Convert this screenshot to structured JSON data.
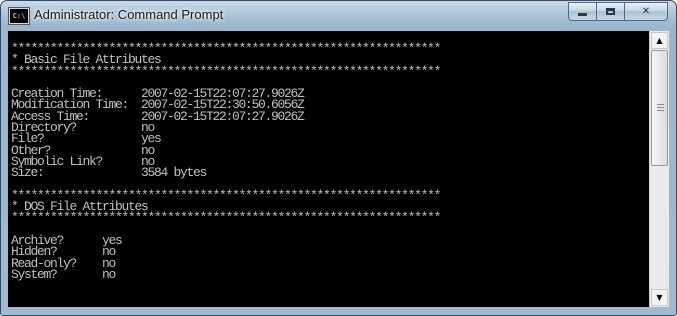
{
  "window": {
    "title": "Administrator: Command Prompt",
    "icon_label": "C:\\"
  },
  "captions": {
    "minimize": "minimize-icon",
    "maximize": "maximize-icon",
    "close": "✕"
  },
  "scrollbar": {
    "up": "▲",
    "down": "▼"
  },
  "console": {
    "lines": [
      "******************************************************************",
      "* Basic File Attributes",
      "******************************************************************",
      "",
      "Creation Time:      2007-02-15T22:07:27.9026Z",
      "Modification Time:  2007-02-15T22:30:50.6056Z",
      "Access Time:        2007-02-15T22:07:27.9026Z",
      "Directory?          no",
      "File?               yes",
      "Other?              no",
      "Symbolic Link?      no",
      "Size:               3584 bytes",
      "",
      "******************************************************************",
      "* DOS File Attributes",
      "******************************************************************",
      "",
      "Archive?      yes",
      "Hidden?       no",
      "Read-only?    no",
      "System?       no"
    ]
  }
}
